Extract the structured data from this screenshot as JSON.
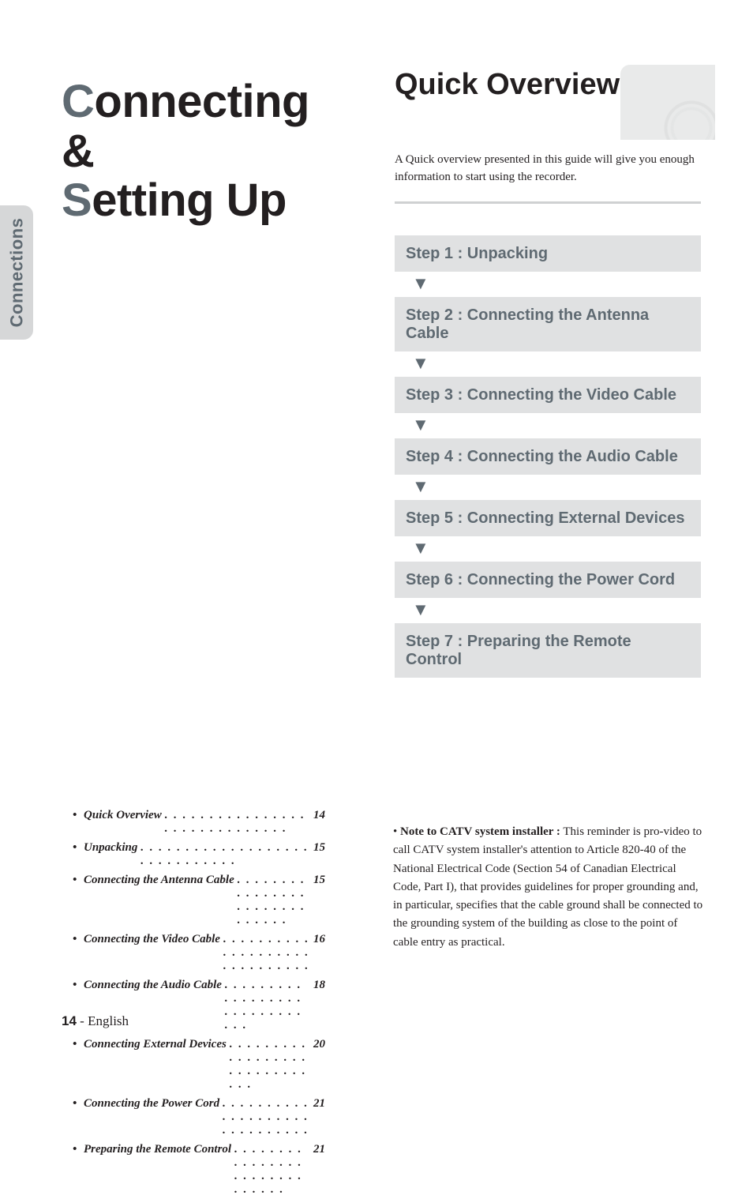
{
  "sidebar": {
    "label": "Connections"
  },
  "title": {
    "line1_accent": "C",
    "line1_rest": "onnecting &",
    "line2_accent": "S",
    "line2_rest": "etting Up"
  },
  "overview": {
    "heading": "Quick Overview",
    "intro": "A Quick overview presented in this guide will give you enough information to start using the recorder."
  },
  "steps": [
    "Step 1 : Unpacking",
    "Step 2 : Connecting the Antenna Cable",
    "Step 3 : Connecting the Video Cable",
    "Step 4 : Connecting the Audio Cable",
    "Step 5 : Connecting External Devices",
    "Step 6 : Connecting the Power Cord",
    "Step 7 : Preparing the Remote Control"
  ],
  "toc": [
    {
      "label": "Quick Overview",
      "page": "14"
    },
    {
      "label": "Unpacking",
      "page": "15"
    },
    {
      "label": "Connecting the Antenna Cable",
      "page": "15"
    },
    {
      "label": "Connecting the Video Cable",
      "page": "16"
    },
    {
      "label": "Connecting the Audio Cable",
      "page": "18"
    },
    {
      "label": "Connecting External Devices",
      "page": "20"
    },
    {
      "label": "Connecting the Power Cord",
      "page": "21"
    },
    {
      "label": "Preparing the Remote Control",
      "page": "21"
    }
  ],
  "note": {
    "bullet": "•",
    "lead": "Note to CATV system installer :",
    "body": " This reminder is pro-video to call CATV system installer's attention to Article 820-40 of the National Electrical Code (Section 54 of Canadian Electrical Code, Part I), that provides guidelines for proper grounding and, in particular, specifies that the cable ground shall be connected to the grounding system of the building as close to the point of cable entry as practical."
  },
  "footer": {
    "page": "14",
    "sep": " - ",
    "lang": "English"
  },
  "glyphs": {
    "down_arrow": "▼",
    "bullet": "•",
    "dots": ". . . . . . . . . . . . . . . . . . . . . . . . . . . . . ."
  }
}
